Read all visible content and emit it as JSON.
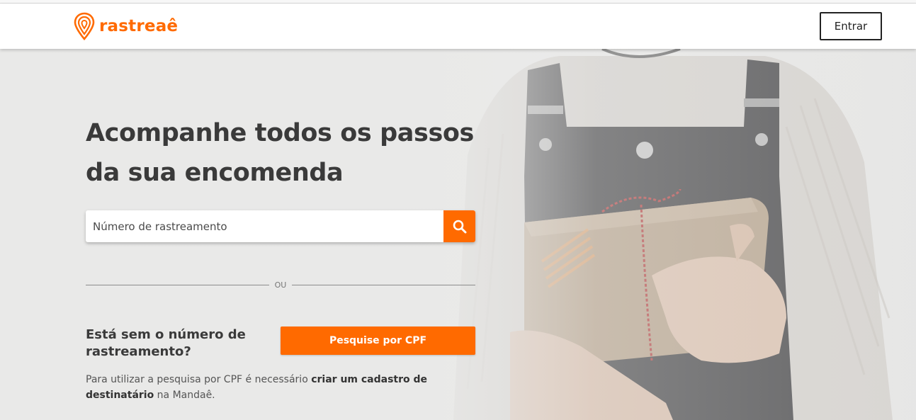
{
  "brand": {
    "name": "rastreaê",
    "color": "#ff6a00"
  },
  "header": {
    "login_label": "Entrar"
  },
  "hero": {
    "headline_line1": "Acompanhe todos os passos",
    "headline_line2": "da sua encomenda"
  },
  "search": {
    "placeholder": "Número de rastreamento",
    "button_icon": "search-icon"
  },
  "divider": {
    "text": "OU"
  },
  "cpf": {
    "question": "Está sem o número de rastreamento?",
    "button_label": "Pesquise por CPF",
    "note_prefix": "Para utilizar a pesquisa por CPF é necessário ",
    "note_link": "criar um cadastro de destinatário",
    "note_suffix": " na Mandaê."
  },
  "colors": {
    "accent": "#ff6a00",
    "text_dark": "#3a3a3a"
  }
}
